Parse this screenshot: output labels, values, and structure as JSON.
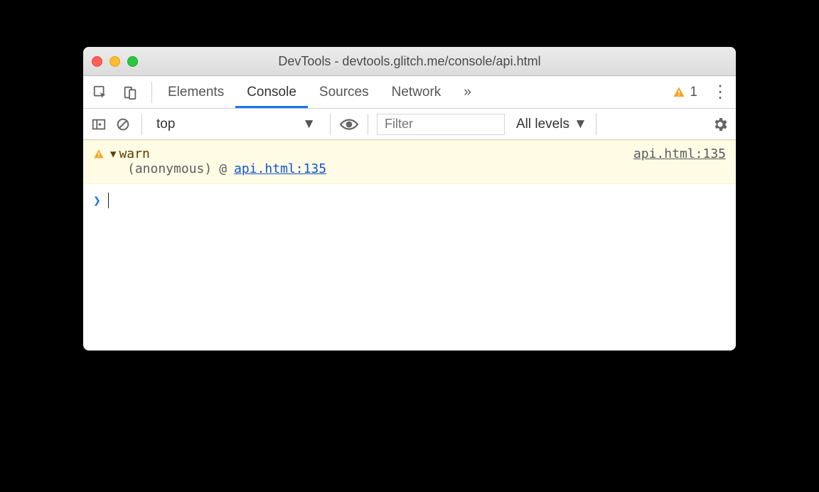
{
  "window": {
    "title": "DevTools - devtools.glitch.me/console/api.html"
  },
  "tabs": {
    "items": [
      "Elements",
      "Console",
      "Sources",
      "Network"
    ],
    "overflow": "»",
    "active_index": 1
  },
  "warning_badge": {
    "count": "1"
  },
  "toolbar": {
    "context": "top",
    "filter_placeholder": "Filter",
    "levels_label": "All levels"
  },
  "console": {
    "warn": {
      "text": "warn",
      "source": "api.html:135",
      "stack_label": "(anonymous)",
      "stack_at": "@",
      "stack_source": "api.html:135"
    }
  }
}
